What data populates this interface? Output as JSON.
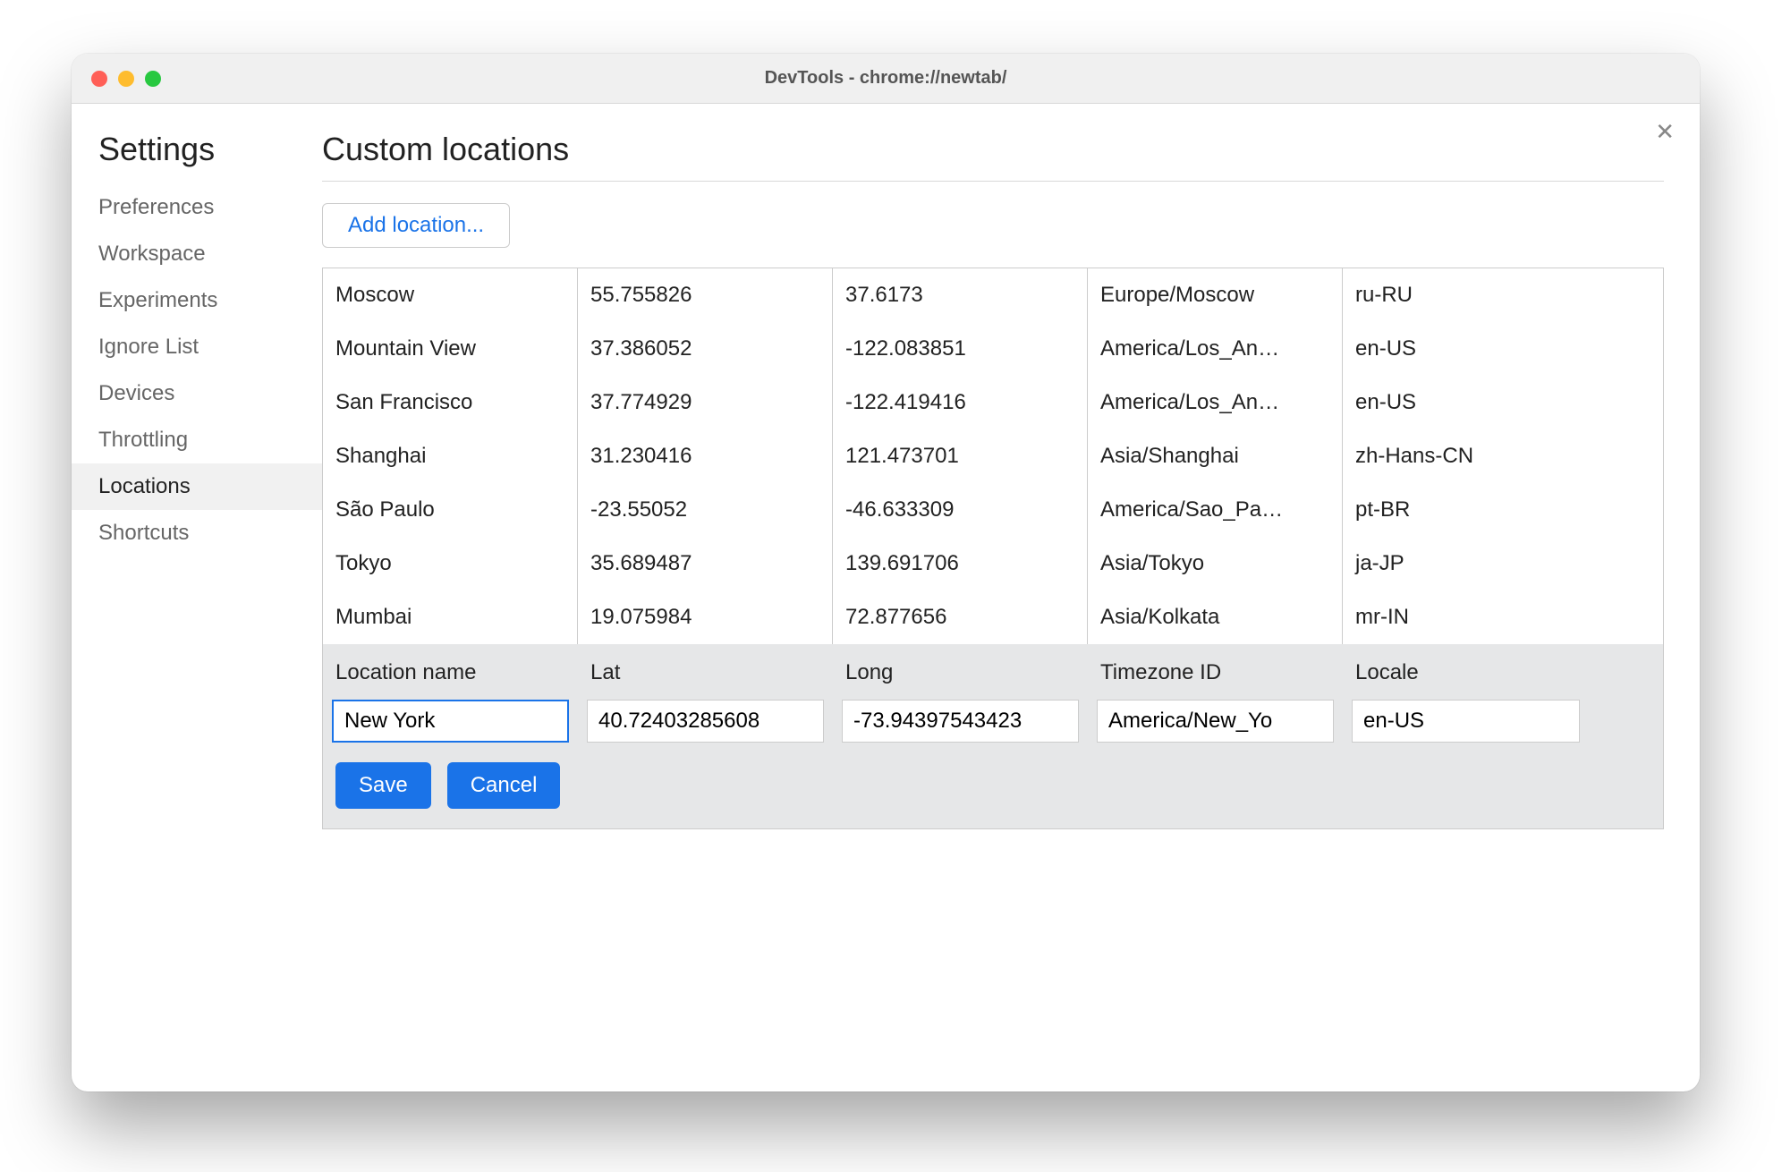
{
  "window": {
    "title": "DevTools - chrome://newtab/"
  },
  "close_glyph": "✕",
  "sidebar": {
    "title": "Settings",
    "items": [
      {
        "label": "Preferences",
        "selected": false
      },
      {
        "label": "Workspace",
        "selected": false
      },
      {
        "label": "Experiments",
        "selected": false
      },
      {
        "label": "Ignore List",
        "selected": false
      },
      {
        "label": "Devices",
        "selected": false
      },
      {
        "label": "Throttling",
        "selected": false
      },
      {
        "label": "Locations",
        "selected": true
      },
      {
        "label": "Shortcuts",
        "selected": false
      }
    ]
  },
  "main": {
    "heading": "Custom locations",
    "add_button": "Add location...",
    "rows": [
      {
        "name": "Moscow",
        "lat": "55.755826",
        "long": "37.6173",
        "tz": "Europe/Moscow",
        "locale": "ru-RU"
      },
      {
        "name": "Mountain View",
        "lat": "37.386052",
        "long": "-122.083851",
        "tz": "America/Los_An…",
        "locale": "en-US"
      },
      {
        "name": "San Francisco",
        "lat": "37.774929",
        "long": "-122.419416",
        "tz": "America/Los_An…",
        "locale": "en-US"
      },
      {
        "name": "Shanghai",
        "lat": "31.230416",
        "long": "121.473701",
        "tz": "Asia/Shanghai",
        "locale": "zh-Hans-CN"
      },
      {
        "name": "São Paulo",
        "lat": "-23.55052",
        "long": "-46.633309",
        "tz": "America/Sao_Pa…",
        "locale": "pt-BR"
      },
      {
        "name": "Tokyo",
        "lat": "35.689487",
        "long": "139.691706",
        "tz": "Asia/Tokyo",
        "locale": "ja-JP"
      },
      {
        "name": "Mumbai",
        "lat": "19.075984",
        "long": "72.877656",
        "tz": "Asia/Kolkata",
        "locale": "mr-IN"
      }
    ],
    "editor": {
      "headers": {
        "name": "Location name",
        "lat": "Lat",
        "long": "Long",
        "tz": "Timezone ID",
        "locale": "Locale"
      },
      "values": {
        "name": "New York",
        "lat": "40.72403285608",
        "long": "-73.94397543423",
        "tz": "America/New_Yo",
        "locale": "en-US"
      },
      "save": "Save",
      "cancel": "Cancel"
    }
  }
}
